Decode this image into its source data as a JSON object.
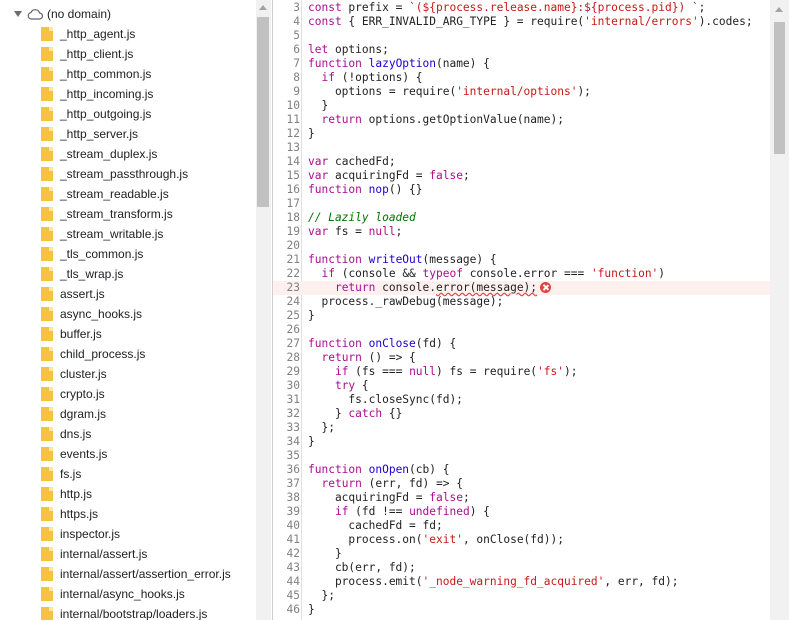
{
  "tree": {
    "root_label": "(no domain)",
    "files": [
      "_http_agent.js",
      "_http_client.js",
      "_http_common.js",
      "_http_incoming.js",
      "_http_outgoing.js",
      "_http_server.js",
      "_stream_duplex.js",
      "_stream_passthrough.js",
      "_stream_readable.js",
      "_stream_transform.js",
      "_stream_writable.js",
      "_tls_common.js",
      "_tls_wrap.js",
      "assert.js",
      "async_hooks.js",
      "buffer.js",
      "child_process.js",
      "cluster.js",
      "crypto.js",
      "dgram.js",
      "dns.js",
      "events.js",
      "fs.js",
      "http.js",
      "https.js",
      "inspector.js",
      "internal/assert.js",
      "internal/assert/assertion_error.js",
      "internal/async_hooks.js",
      "internal/bootstrap/loaders.js"
    ]
  },
  "editor": {
    "error_line": 23,
    "lines": [
      {
        "n": "3",
        "tokens": [
          [
            "kw",
            "const "
          ],
          [
            "",
            "prefix = "
          ],
          [
            "str",
            "`(${process.release.name}:${process.pid}) `"
          ],
          [
            "",
            ";"
          ]
        ]
      },
      {
        "n": "4",
        "tokens": [
          [
            "kw",
            "const "
          ],
          [
            "",
            "{ ERR_INVALID_ARG_TYPE } = require("
          ],
          [
            "str",
            "'internal/errors'"
          ],
          [
            "",
            ").codes;"
          ]
        ]
      },
      {
        "n": "5",
        "tokens": []
      },
      {
        "n": "6",
        "tokens": [
          [
            "kw",
            "let "
          ],
          [
            "",
            "options;"
          ]
        ]
      },
      {
        "n": "7",
        "tokens": [
          [
            "kw",
            "function "
          ],
          [
            "fn",
            "lazyOption"
          ],
          [
            "",
            "(name) {"
          ]
        ]
      },
      {
        "n": "8",
        "tokens": [
          [
            "",
            "  "
          ],
          [
            "kw",
            "if "
          ],
          [
            "",
            "(!options) {"
          ]
        ]
      },
      {
        "n": "9",
        "tokens": [
          [
            "",
            "    options = require("
          ],
          [
            "str",
            "'internal/options'"
          ],
          [
            "",
            ");"
          ]
        ]
      },
      {
        "n": "10",
        "tokens": [
          [
            "",
            "  }"
          ]
        ]
      },
      {
        "n": "11",
        "tokens": [
          [
            "",
            "  "
          ],
          [
            "kw",
            "return "
          ],
          [
            "",
            "options.getOptionValue(name);"
          ]
        ]
      },
      {
        "n": "12",
        "tokens": [
          [
            "",
            "}"
          ]
        ]
      },
      {
        "n": "13",
        "tokens": []
      },
      {
        "n": "14",
        "tokens": [
          [
            "kw",
            "var "
          ],
          [
            "",
            "cachedFd;"
          ]
        ]
      },
      {
        "n": "15",
        "tokens": [
          [
            "kw",
            "var "
          ],
          [
            "",
            "acquiringFd = "
          ],
          [
            "kw",
            "false"
          ],
          [
            "",
            ";"
          ]
        ]
      },
      {
        "n": "16",
        "tokens": [
          [
            "kw",
            "function "
          ],
          [
            "fn",
            "nop"
          ],
          [
            "",
            "() {}"
          ]
        ]
      },
      {
        "n": "17",
        "tokens": []
      },
      {
        "n": "18",
        "tokens": [
          [
            "cm",
            "// Lazily loaded"
          ]
        ]
      },
      {
        "n": "19",
        "tokens": [
          [
            "kw",
            "var "
          ],
          [
            "",
            "fs = "
          ],
          [
            "kw",
            "null"
          ],
          [
            "",
            ";"
          ]
        ]
      },
      {
        "n": "20",
        "tokens": []
      },
      {
        "n": "21",
        "tokens": [
          [
            "kw",
            "function "
          ],
          [
            "fn",
            "writeOut"
          ],
          [
            "",
            "(message) {"
          ]
        ]
      },
      {
        "n": "22",
        "tokens": [
          [
            "",
            "  "
          ],
          [
            "kw",
            "if "
          ],
          [
            "",
            "(console && "
          ],
          [
            "kw",
            "typeof "
          ],
          [
            "",
            "console.error === "
          ],
          [
            "str",
            "'function'"
          ],
          [
            "",
            ")"
          ]
        ]
      },
      {
        "n": "23",
        "tokens": [
          [
            "",
            "    "
          ],
          [
            "kw",
            "return "
          ],
          [
            "",
            "console."
          ],
          [
            "squig",
            "error(message);"
          ]
        ]
      },
      {
        "n": "24",
        "tokens": [
          [
            "",
            "  process._rawDebug(message);"
          ]
        ]
      },
      {
        "n": "25",
        "tokens": [
          [
            "",
            "}"
          ]
        ]
      },
      {
        "n": "26",
        "tokens": []
      },
      {
        "n": "27",
        "tokens": [
          [
            "kw",
            "function "
          ],
          [
            "fn",
            "onClose"
          ],
          [
            "",
            "(fd) {"
          ]
        ]
      },
      {
        "n": "28",
        "tokens": [
          [
            "",
            "  "
          ],
          [
            "kw",
            "return "
          ],
          [
            "",
            "() => {"
          ]
        ]
      },
      {
        "n": "29",
        "tokens": [
          [
            "",
            "    "
          ],
          [
            "kw",
            "if "
          ],
          [
            "",
            "(fs === "
          ],
          [
            "kw",
            "null"
          ],
          [
            "",
            ") fs = require("
          ],
          [
            "str",
            "'fs'"
          ],
          [
            "",
            ");"
          ]
        ]
      },
      {
        "n": "30",
        "tokens": [
          [
            "",
            "    "
          ],
          [
            "kw",
            "try "
          ],
          [
            "",
            "{"
          ]
        ]
      },
      {
        "n": "31",
        "tokens": [
          [
            "",
            "      fs.closeSync(fd);"
          ]
        ]
      },
      {
        "n": "32",
        "tokens": [
          [
            "",
            "    } "
          ],
          [
            "kw",
            "catch "
          ],
          [
            "",
            "{}"
          ]
        ]
      },
      {
        "n": "33",
        "tokens": [
          [
            "",
            "  };"
          ]
        ]
      },
      {
        "n": "34",
        "tokens": [
          [
            "",
            "}"
          ]
        ]
      },
      {
        "n": "35",
        "tokens": []
      },
      {
        "n": "36",
        "tokens": [
          [
            "kw",
            "function "
          ],
          [
            "fn",
            "onOpen"
          ],
          [
            "",
            "(cb) {"
          ]
        ]
      },
      {
        "n": "37",
        "tokens": [
          [
            "",
            "  "
          ],
          [
            "kw",
            "return "
          ],
          [
            "",
            "(err, fd) => {"
          ]
        ]
      },
      {
        "n": "38",
        "tokens": [
          [
            "",
            "    acquiringFd = "
          ],
          [
            "kw",
            "false"
          ],
          [
            "",
            ";"
          ]
        ]
      },
      {
        "n": "39",
        "tokens": [
          [
            "",
            "    "
          ],
          [
            "kw",
            "if "
          ],
          [
            "",
            "(fd !== "
          ],
          [
            "kw",
            "undefined"
          ],
          [
            "",
            ") {"
          ]
        ]
      },
      {
        "n": "40",
        "tokens": [
          [
            "",
            "      cachedFd = fd;"
          ]
        ]
      },
      {
        "n": "41",
        "tokens": [
          [
            "",
            "      process.on("
          ],
          [
            "str",
            "'exit'"
          ],
          [
            "",
            ", onClose(fd));"
          ]
        ]
      },
      {
        "n": "42",
        "tokens": [
          [
            "",
            "    }"
          ]
        ]
      },
      {
        "n": "43",
        "tokens": [
          [
            "",
            "    cb(err, fd);"
          ]
        ]
      },
      {
        "n": "44",
        "tokens": [
          [
            "",
            "    process.emit("
          ],
          [
            "str",
            "'_node_warning_fd_acquired'"
          ],
          [
            "",
            ", err, fd);"
          ]
        ]
      },
      {
        "n": "45",
        "tokens": [
          [
            "",
            "  };"
          ]
        ]
      },
      {
        "n": "46",
        "tokens": [
          [
            "",
            "}"
          ]
        ]
      }
    ]
  },
  "icons": {
    "tree_root": "cloud-icon",
    "file": "js-file-icon",
    "error": "error-icon"
  },
  "colors": {
    "keyword": "#aa0d91",
    "string": "#c41a16",
    "function_name": "#1c00cf",
    "comment": "#007400",
    "error_line_bg": "#fff0f0",
    "error": "#e0443e",
    "file_icon": "#f4c342"
  }
}
